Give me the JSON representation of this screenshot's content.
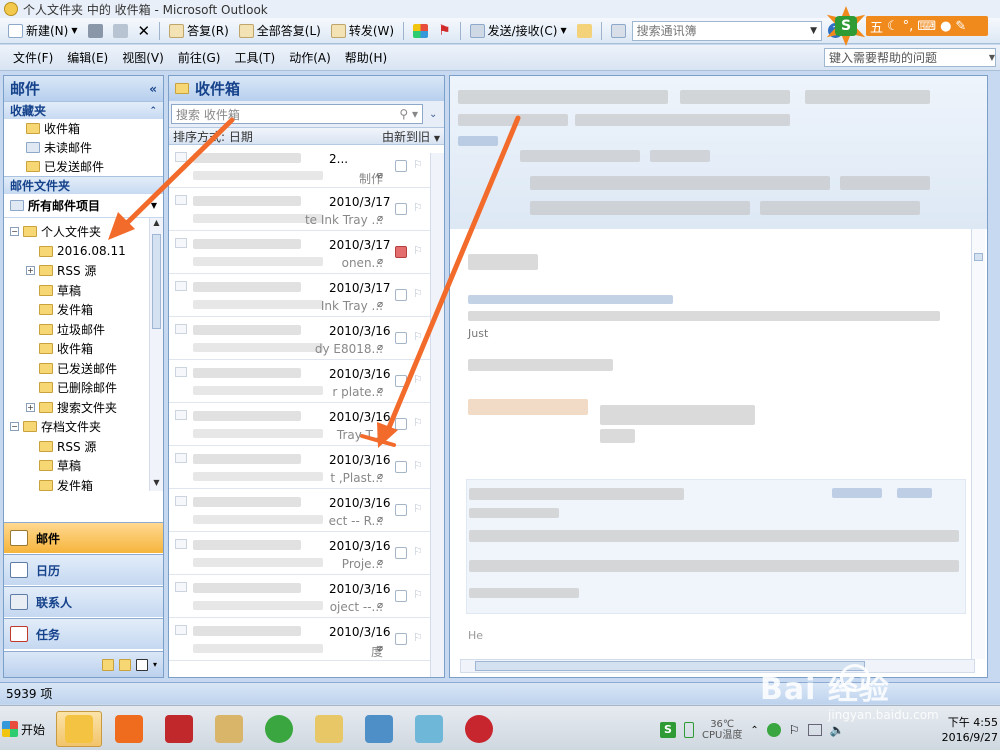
{
  "window": {
    "title": "个人文件夹 中的 收件箱 - Microsoft Outlook"
  },
  "toolbar": {
    "new_label": "新建(N)",
    "reply_label": "答复(R)",
    "reply_all_label": "全部答复(L)",
    "forward_label": "转发(W)",
    "send_receive_label": "发送/接收(C)",
    "search_address_placeholder": "搜索通讯簿"
  },
  "menu": {
    "items": [
      "文件(F)",
      "编辑(E)",
      "视图(V)",
      "前往(G)",
      "工具(T)",
      "动作(A)",
      "帮助(H)"
    ],
    "help_placeholder": "键入需要帮助的问题"
  },
  "ime": {
    "badge": "S",
    "mode": "五"
  },
  "nav": {
    "title": "邮件",
    "favorites_header": "收藏夹",
    "favorites": [
      "收件箱",
      "未读邮件",
      "已发送邮件"
    ],
    "mail_folders_header": "邮件文件夹",
    "all_mail_label": "所有邮件项目",
    "tree": [
      {
        "label": "个人文件夹",
        "level": 0,
        "expander": "−"
      },
      {
        "label": "2016.08.11",
        "level": 1,
        "expander": ""
      },
      {
        "label": "RSS 源",
        "level": 1,
        "expander": "+"
      },
      {
        "label": "草稿",
        "level": 1,
        "expander": ""
      },
      {
        "label": "发件箱",
        "level": 1,
        "expander": ""
      },
      {
        "label": "垃圾邮件",
        "level": 1,
        "expander": ""
      },
      {
        "label": "收件箱",
        "level": 1,
        "expander": ""
      },
      {
        "label": "已发送邮件",
        "level": 1,
        "expander": ""
      },
      {
        "label": "已删除邮件",
        "level": 1,
        "expander": ""
      },
      {
        "label": "搜索文件夹",
        "level": 1,
        "expander": "+"
      },
      {
        "label": "存档文件夹",
        "level": 0,
        "expander": "−"
      },
      {
        "label": "RSS 源",
        "level": 1,
        "expander": ""
      },
      {
        "label": "草稿",
        "level": 1,
        "expander": ""
      },
      {
        "label": "发件箱",
        "level": 1,
        "expander": ""
      }
    ],
    "buttons": [
      "邮件",
      "日历",
      "联系人",
      "任务"
    ]
  },
  "list": {
    "title": "收件箱",
    "search_placeholder": "搜索 收件箱",
    "sort_by": "排序方式: 日期",
    "sort_order": "由新到旧",
    "messages": [
      {
        "date": "2...",
        "subject": "制作",
        "flagged": false
      },
      {
        "date": "2010/3/17",
        "subject": "te Ink Tray ...",
        "flagged": false
      },
      {
        "date": "2010/3/17",
        "subject": "onen...",
        "flagged": true
      },
      {
        "date": "2010/3/17",
        "subject": "Ink Tray ...",
        "flagged": false
      },
      {
        "date": "2010/3/16",
        "subject": "dy E8018...",
        "flagged": false
      },
      {
        "date": "2010/3/16",
        "subject": "r plate...",
        "flagged": false
      },
      {
        "date": "2010/3/16",
        "subject": "Tray T...",
        "flagged": false
      },
      {
        "date": "2010/3/16",
        "subject": "t ,Plast...",
        "flagged": false
      },
      {
        "date": "2010/3/16",
        "subject": "ect -- R...",
        "flagged": false
      },
      {
        "date": "2010/3/16",
        "subject": "Proje...",
        "flagged": false
      },
      {
        "date": "2010/3/16",
        "subject": "oject --...",
        "flagged": false
      },
      {
        "date": "2010/3/16",
        "subject": "度",
        "flagged": false
      }
    ]
  },
  "reading": {
    "greeting": "Just",
    "footer": "He"
  },
  "status": {
    "item_count": "5939 项"
  },
  "taskbar": {
    "start_label": "开始",
    "temp_value": "36℃",
    "temp_label": "CPU温度",
    "time": "下午 4:55",
    "date": "2016/9/27"
  },
  "watermark": {
    "brand": "Bai 经验",
    "site": "jingyan.baidu.com"
  },
  "colors": {
    "accent_orange": "#f26b2b",
    "nav_blue": "#15428b",
    "active_tab": "#f6b53c"
  }
}
